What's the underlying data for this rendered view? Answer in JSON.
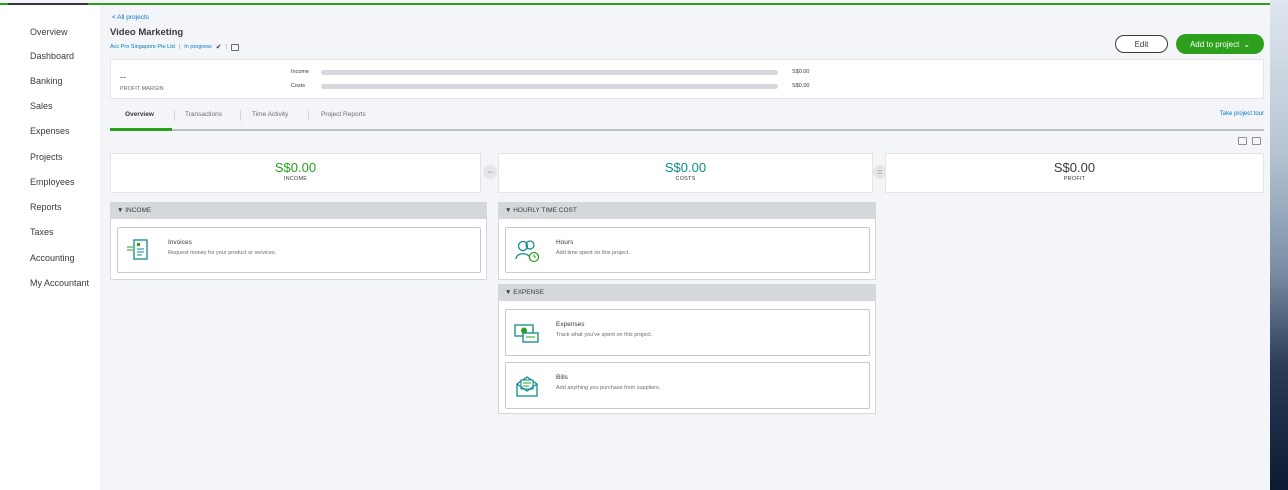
{
  "sidebar": {
    "items": [
      {
        "label": "Overview"
      },
      {
        "label": "Dashboard"
      },
      {
        "label": "Banking"
      },
      {
        "label": "Sales"
      },
      {
        "label": "Expenses"
      },
      {
        "label": "Projects"
      },
      {
        "label": "Employees"
      },
      {
        "label": "Reports"
      },
      {
        "label": "Taxes"
      },
      {
        "label": "Accounting"
      },
      {
        "label": "My Accountant"
      }
    ]
  },
  "header": {
    "breadcrumb": "< All projects",
    "title": "Video Marketing",
    "customer": "Acc Pro Singapore Pte Ltd",
    "status": "In progress",
    "edit_label": "Edit",
    "add_label": "Add to project"
  },
  "margin": {
    "value": "--",
    "label": "PROFIT MARGIN",
    "income_label": "Income",
    "income_amount": "S$0.00",
    "costs_label": "Costs",
    "costs_amount": "S$0.00"
  },
  "tabs": [
    {
      "label": "Overview"
    },
    {
      "label": "Transactions"
    },
    {
      "label": "Time Activity"
    },
    {
      "label": "Project Reports"
    }
  ],
  "tour_link": "Take project tour",
  "summary": {
    "income": {
      "amount": "S$0.00",
      "label": "INCOME"
    },
    "costs": {
      "amount": "S$0.00",
      "label": "COSTS"
    },
    "profit": {
      "amount": "S$0.00",
      "label": "PROFIT"
    },
    "minus_sign": "−",
    "equals_sign": "="
  },
  "sections": {
    "income": {
      "title": "▼ INCOME",
      "items": [
        {
          "title": "Invoices",
          "desc": "Request money for your product or services."
        }
      ]
    },
    "hourly": {
      "title": "▼ HOURLY TIME COST",
      "items": [
        {
          "title": "Hours",
          "desc": "Add time spent on this project."
        }
      ]
    },
    "expense": {
      "title": "▼ EXPENSE",
      "items": [
        {
          "title": "Expenses",
          "desc": "Track what you've spent on this project."
        },
        {
          "title": "Bills",
          "desc": "Add anything you purchase from suppliers."
        }
      ]
    }
  },
  "colors": {
    "brand_green": "#2ca01c",
    "link_blue": "#0077c5",
    "income_green": "#2ca01c",
    "costs_teal": "#108a8a"
  }
}
